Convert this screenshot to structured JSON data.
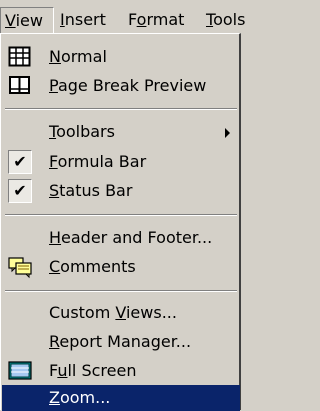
{
  "menubar": {
    "items": [
      {
        "pre": "",
        "acc": "V",
        "post": "iew"
      },
      {
        "pre": "",
        "acc": "I",
        "post": "nsert"
      },
      {
        "pre": "F",
        "acc": "o",
        "post": "rmat"
      },
      {
        "pre": "",
        "acc": "T",
        "post": "ools"
      }
    ]
  },
  "menu": {
    "items": [
      {
        "pre": "",
        "acc": "N",
        "post": "ormal",
        "icon": "normal-view-icon"
      },
      {
        "pre": "",
        "acc": "P",
        "post": "age Break Preview",
        "icon": "page-break-preview-icon"
      },
      {
        "pre": "",
        "acc": "T",
        "post": "oolbars",
        "submenu": true
      },
      {
        "pre": "",
        "acc": "F",
        "post": "ormula Bar",
        "checked": true,
        "check_glyph": "✔"
      },
      {
        "pre": "",
        "acc": "S",
        "post": "tatus Bar",
        "checked": true,
        "check_glyph": "✔"
      },
      {
        "pre": "",
        "acc": "H",
        "post": "eader and Footer...",
        "icon": null
      },
      {
        "pre": "",
        "acc": "C",
        "post": "omments",
        "icon": "comments-icon"
      },
      {
        "pre": "Custom ",
        "acc": "V",
        "post": "iews..."
      },
      {
        "pre": "",
        "acc": "R",
        "post": "eport Manager..."
      },
      {
        "pre": "F",
        "acc": "u",
        "post": "ll Screen",
        "icon": "full-screen-icon"
      },
      {
        "pre": "",
        "acc": "Z",
        "post": "oom...",
        "selected": true
      }
    ]
  },
  "colors": {
    "face": "#d4d0c8",
    "highlight": "#0a246a",
    "highlight_text": "#ffffff"
  }
}
